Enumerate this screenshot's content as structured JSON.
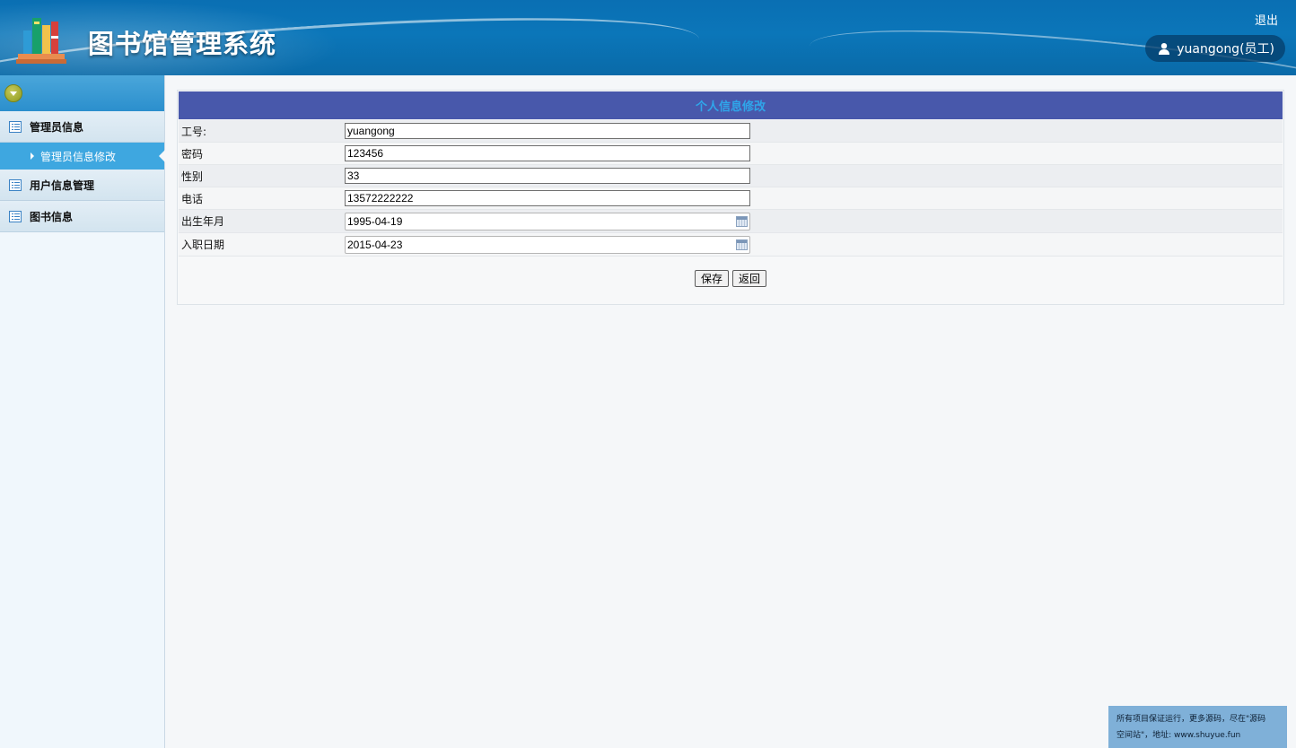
{
  "header": {
    "app_title": "图书馆管理系统",
    "logout_label": "退出",
    "user_label": "yuangong(员工)"
  },
  "sidebar": {
    "groups": [
      {
        "label": "管理员信息",
        "items": [
          {
            "label": "管理员信息修改",
            "active": true
          }
        ]
      },
      {
        "label": "用户信息管理",
        "items": []
      },
      {
        "label": "图书信息",
        "items": []
      }
    ]
  },
  "form": {
    "title": "个人信息修改",
    "fields": [
      {
        "label": "工号:",
        "value": "yuangong"
      },
      {
        "label": "密码",
        "value": "123456"
      },
      {
        "label": "性别",
        "value": "33"
      },
      {
        "label": "电话",
        "value": "13572222222"
      },
      {
        "label": "出生年月",
        "value": "1995-04-19",
        "type": "date"
      },
      {
        "label": "入职日期",
        "value": "2015-04-23",
        "type": "date"
      }
    ],
    "save_label": "保存",
    "back_label": "返回"
  },
  "watermark": {
    "line1": "所有项目保证运行，更多源码，尽在\"源码",
    "line2": "空间站\"，地址: www.shuyue.fun"
  },
  "colors": {
    "header_bg": "#0b76b9",
    "form_title_bg": "#4858ab",
    "form_title_text": "#2fa6ea",
    "active_menu_bg": "#3ea7e0"
  }
}
